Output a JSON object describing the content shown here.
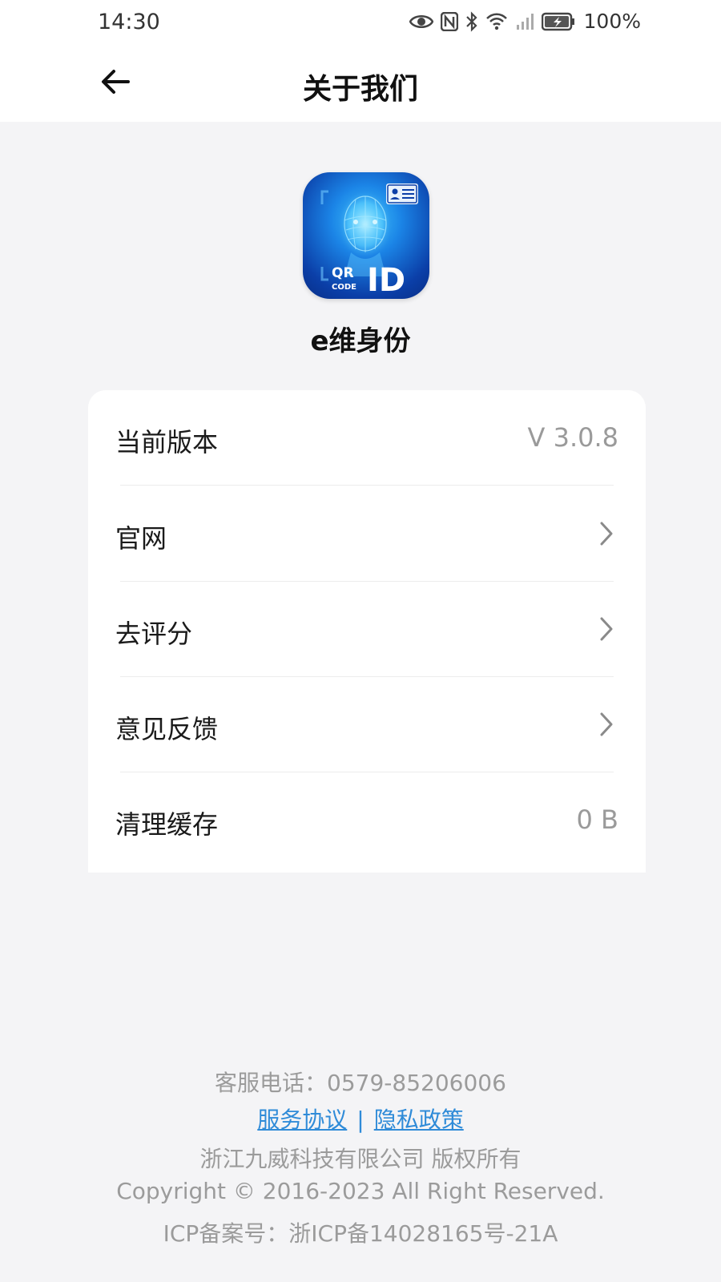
{
  "status_bar": {
    "time": "14:30",
    "battery_percent": "100%",
    "icons": [
      "eye-icon",
      "nfc-icon",
      "bluetooth-icon",
      "wifi-icon",
      "signal-icon",
      "battery-icon"
    ]
  },
  "app_bar": {
    "title": "关于我们",
    "back_icon": "arrow-left-icon"
  },
  "app": {
    "name": "e维身份",
    "logo_text_qr": "QR",
    "logo_text_code": "CODE",
    "logo_text_id": "ID"
  },
  "settings": {
    "rows": [
      {
        "label": "当前版本",
        "value": "V 3.0.8"
      },
      {
        "label": "官网"
      },
      {
        "label": "去评分"
      },
      {
        "label": "意见反馈"
      },
      {
        "label": "清理缓存",
        "value": "0 B"
      }
    ]
  },
  "footer": {
    "phone": "客服电话：0579-85206006",
    "service_agreement": "服务协议",
    "separator": "|",
    "privacy_policy": "隐私政策",
    "company": "浙江九威科技有限公司 版权所有",
    "copyright": "Copyright © 2016-2023 All Right Reserved.",
    "icp": "ICP备案号：浙ICP备14028165号-21A"
  },
  "colors": {
    "link": "#2f8bd8",
    "background": "#f4f4f6",
    "muted_text": "#9b9b9b"
  }
}
